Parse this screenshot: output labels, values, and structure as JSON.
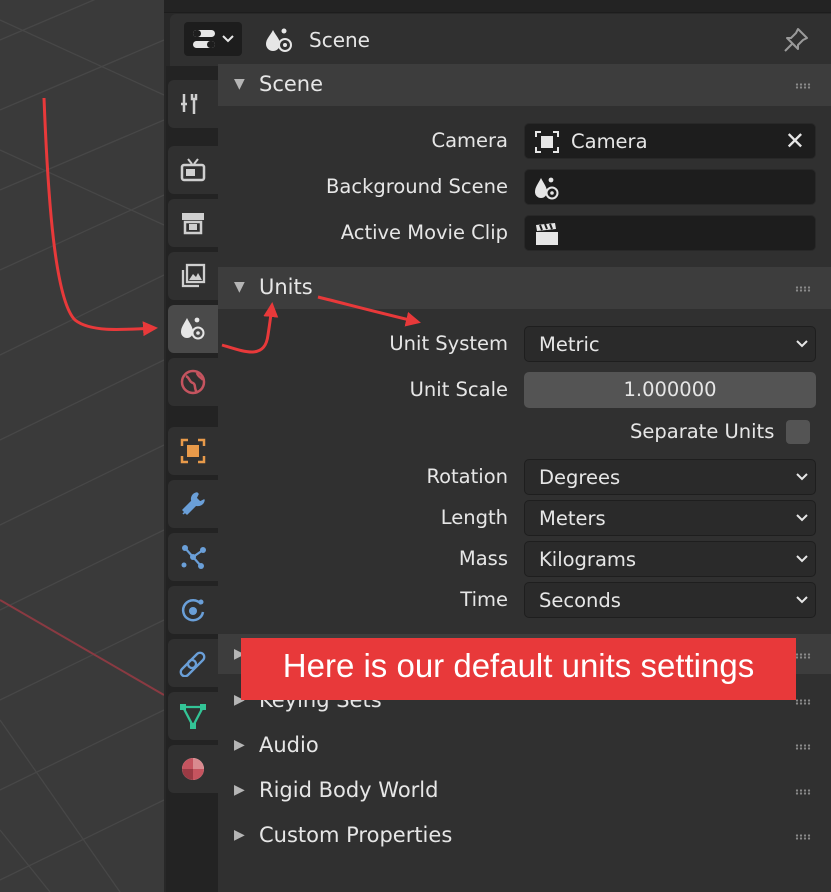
{
  "header": {
    "editor_type_icon": "properties-editor-icon",
    "title": "Scene",
    "pin_icon": "pin-icon",
    "title_icon": "scene-icon"
  },
  "tabs": [
    {
      "name": "tool",
      "icon": "tool-icon"
    },
    {
      "name": "render",
      "icon": "render-icon"
    },
    {
      "name": "output",
      "icon": "output-icon"
    },
    {
      "name": "view-layer",
      "icon": "view-layer-icon"
    },
    {
      "name": "scene",
      "icon": "scene-icon",
      "active": true
    },
    {
      "name": "world",
      "icon": "world-icon"
    },
    {
      "name": "object",
      "icon": "object-icon"
    },
    {
      "name": "modifiers",
      "icon": "wrench-icon"
    },
    {
      "name": "particles",
      "icon": "particles-icon"
    },
    {
      "name": "physics",
      "icon": "physics-icon"
    },
    {
      "name": "constraints",
      "icon": "constraints-icon"
    },
    {
      "name": "data",
      "icon": "mesh-data-icon"
    },
    {
      "name": "material",
      "icon": "material-icon"
    }
  ],
  "scene_panel": {
    "title": "Scene",
    "camera_label": "Camera",
    "camera_value": "Camera",
    "background_label": "Background Scene",
    "movie_clip_label": "Active Movie Clip"
  },
  "units_panel": {
    "title": "Units",
    "unit_system_label": "Unit System",
    "unit_system_value": "Metric",
    "unit_scale_label": "Unit Scale",
    "unit_scale_value": "1.000000",
    "separate_units_label": "Separate Units",
    "separate_units_checked": false,
    "rotation_label": "Rotation",
    "rotation_value": "Degrees",
    "length_label": "Length",
    "length_value": "Meters",
    "mass_label": "Mass",
    "mass_value": "Kilograms",
    "time_label": "Time",
    "time_value": "Seconds"
  },
  "collapsed_panels": {
    "keying_sets": "Keying Sets",
    "audio": "Audio",
    "rigid_body": "Rigid Body World",
    "custom_props": "Custom Properties"
  },
  "annotation": {
    "banner": "Here is our default units settings",
    "color": "#e8393a"
  },
  "colors": {
    "accent_red": "#e8393a",
    "panel_bg": "#303030",
    "field_bg": "#1d1d1d"
  }
}
